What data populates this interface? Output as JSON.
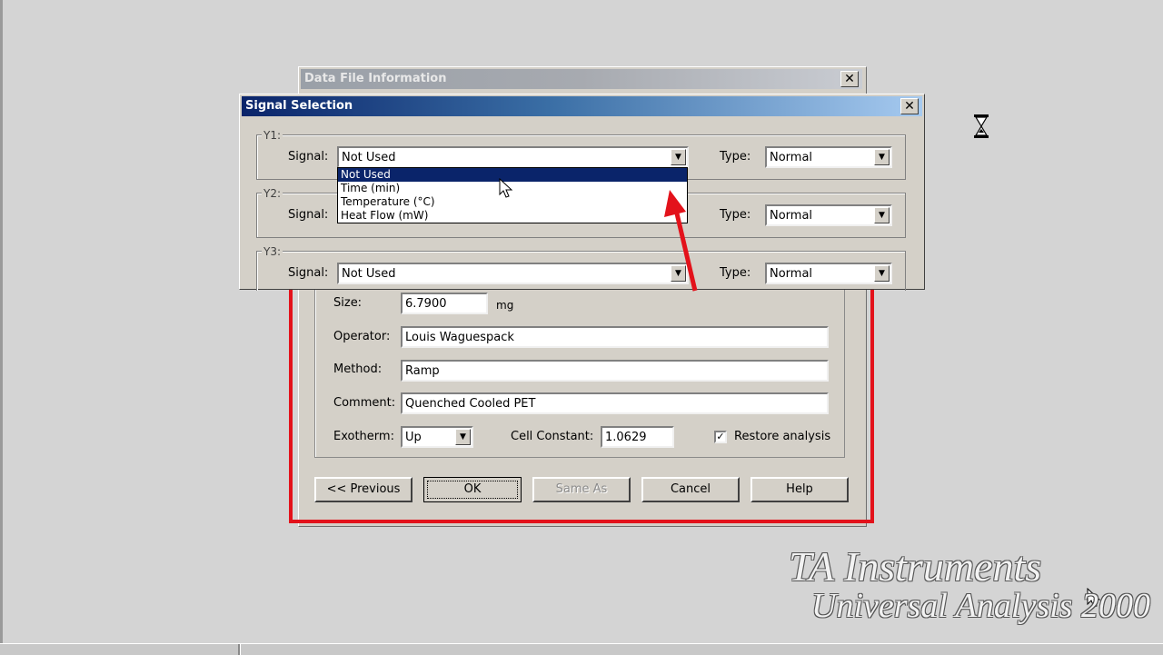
{
  "data_file_info": {
    "title": "Data File Information",
    "fields": {
      "size_label": "Size:",
      "size_value": "6.7900",
      "size_unit": "mg",
      "operator_label": "Operator:",
      "operator_value": "Louis Waguespack",
      "method_label": "Method:",
      "method_value": "Ramp",
      "comment_label": "Comment:",
      "comment_value": "Quenched Cooled PET",
      "exotherm_label": "Exotherm:",
      "exotherm_value": "Up",
      "cell_constant_label": "Cell Constant:",
      "cell_constant_value": "1.0629",
      "restore_label": "Restore analysis",
      "restore_checked": true
    },
    "buttons": {
      "previous": "<< Previous",
      "ok": "OK",
      "same_as": "Same As",
      "cancel": "Cancel",
      "help": "Help"
    }
  },
  "signal_selection": {
    "title": "Signal Selection",
    "close_glyph": "✕",
    "groups": [
      {
        "caption": "Y1:",
        "signal_label": "Signal:",
        "signal_value": "Not Used",
        "type_label": "Type:",
        "type_value": "Normal"
      },
      {
        "caption": "Y2:",
        "signal_label": "Signal:",
        "signal_value": "",
        "type_label": "Type:",
        "type_value": "Normal"
      },
      {
        "caption": "Y3:",
        "signal_label": "Signal:",
        "signal_value": "Not Used",
        "type_label": "Type:",
        "type_value": "Normal"
      }
    ],
    "dropdown_options": [
      "Not Used",
      "Time (min)",
      "Temperature (°C)",
      "Heat Flow (mW)"
    ],
    "dropdown_selected_index": 0
  },
  "watermark": {
    "line1": "TA Instruments",
    "line2": "Universal Analysis 2000"
  },
  "annotation_color": "#e3121b",
  "icons": [
    "hourglass-icon",
    "mouse-pointer-icon",
    "red-arrow-annotation"
  ]
}
